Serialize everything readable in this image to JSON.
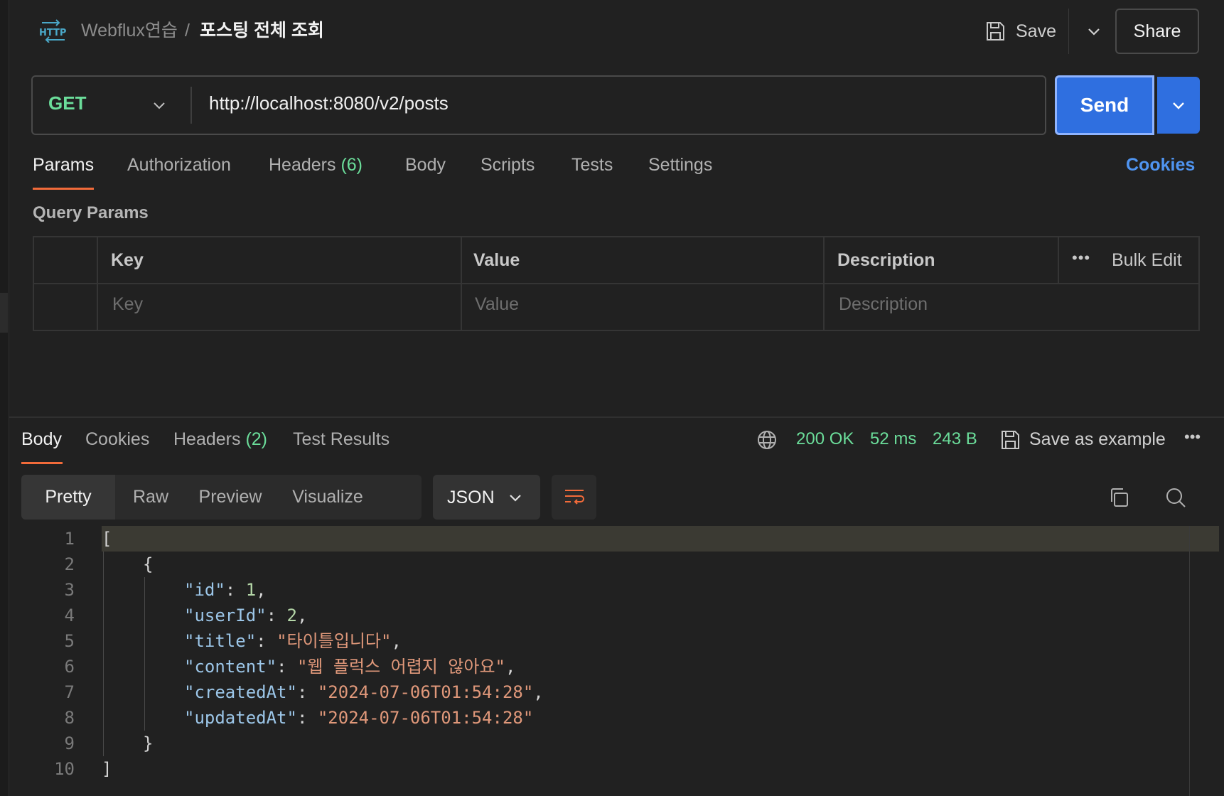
{
  "header": {
    "collection": "Webflux연습",
    "separator": "/",
    "request_name": "포스팅 전체 조회",
    "save_label": "Save",
    "share_label": "Share"
  },
  "request": {
    "method": "GET",
    "url": "http://localhost:8080/v2/posts",
    "send_label": "Send"
  },
  "request_tabs": [
    {
      "label": "Params",
      "count": ""
    },
    {
      "label": "Authorization",
      "count": ""
    },
    {
      "label": "Headers",
      "count": "(6)"
    },
    {
      "label": "Body",
      "count": ""
    },
    {
      "label": "Scripts",
      "count": ""
    },
    {
      "label": "Tests",
      "count": ""
    },
    {
      "label": "Settings",
      "count": ""
    }
  ],
  "cookies_link": "Cookies",
  "query_params": {
    "title": "Query Params",
    "columns": [
      "Key",
      "Value",
      "Description"
    ],
    "bulk_edit": "Bulk Edit",
    "placeholders": {
      "key": "Key",
      "value": "Value",
      "description": "Description"
    }
  },
  "response_tabs": [
    {
      "label": "Body",
      "count": ""
    },
    {
      "label": "Cookies",
      "count": ""
    },
    {
      "label": "Headers",
      "count": "(2)"
    },
    {
      "label": "Test Results",
      "count": ""
    }
  ],
  "response_status": {
    "status": "200 OK",
    "time": "52 ms",
    "size": "243 B",
    "save_example": "Save as example"
  },
  "view_modes": [
    "Pretty",
    "Raw",
    "Preview",
    "Visualize"
  ],
  "format": "JSON",
  "response_body": {
    "line_numbers": [
      "1",
      "2",
      "3",
      "4",
      "5",
      "6",
      "7",
      "8",
      "9",
      "10"
    ],
    "open_bracket": "[",
    "open_brace": "{",
    "fields": [
      {
        "key": "\"id\"",
        "value": "1",
        "type": "num",
        "comma": ","
      },
      {
        "key": "\"userId\"",
        "value": "2",
        "type": "num",
        "comma": ","
      },
      {
        "key": "\"title\"",
        "value": "\"타이틀입니다\"",
        "type": "str",
        "comma": ","
      },
      {
        "key": "\"content\"",
        "value": "\"웹 플럭스 어렵지 않아요\"",
        "type": "str",
        "comma": ","
      },
      {
        "key": "\"createdAt\"",
        "value": "\"2024-07-06T01:54:28\"",
        "type": "str",
        "comma": ","
      },
      {
        "key": "\"updatedAt\"",
        "value": "\"2024-07-06T01:54:28\"",
        "type": "str",
        "comma": ""
      }
    ],
    "close_brace": "}",
    "close_bracket": "]"
  },
  "colors": {
    "accent_orange": "#f26b3a",
    "send_blue": "#2f6fe0",
    "link_blue": "#4f94f0",
    "success_green": "#6bdd9a",
    "background": "#212121"
  },
  "icons": [
    "http-icon",
    "save-icon",
    "chevron-down-icon",
    "globe-icon",
    "more-icon",
    "wrap-lines-icon",
    "copy-icon",
    "search-icon"
  ]
}
